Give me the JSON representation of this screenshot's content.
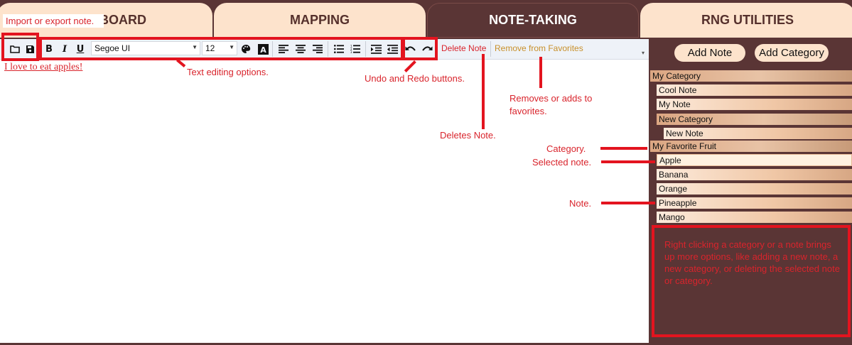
{
  "tabs": [
    {
      "label": "DASHBOARD",
      "active": false
    },
    {
      "label": "MAPPING",
      "active": false
    },
    {
      "label": "NOTE-TAKING",
      "active": true
    },
    {
      "label": "RNG UTILITIES",
      "active": false
    }
  ],
  "toolbar": {
    "open_icon": "folder-open-icon",
    "save_icon": "save-icon",
    "bold": "B",
    "italic": "I",
    "underline": "U",
    "font_family": "Segoe UI",
    "font_size": "12",
    "delete_note": "Delete Note",
    "remove_favorites": "Remove from Favorites"
  },
  "editor": {
    "body_text": "I love to eat apples!"
  },
  "sidebar": {
    "add_note": "Add Note",
    "add_category": "Add Category",
    "tree": [
      {
        "label": "My Category",
        "kind": "category"
      },
      {
        "label": "Cool Note",
        "kind": "note"
      },
      {
        "label": "My Note",
        "kind": "note"
      },
      {
        "label": "New Category",
        "kind": "category"
      },
      {
        "label": "New Note",
        "kind": "note"
      },
      {
        "label": "My Favorite Fruit",
        "kind": "category"
      },
      {
        "label": "Apple",
        "kind": "note",
        "selected": true
      },
      {
        "label": "Banana",
        "kind": "note"
      },
      {
        "label": "Orange",
        "kind": "note"
      },
      {
        "label": "Pineapple",
        "kind": "note"
      },
      {
        "label": "Mango",
        "kind": "note"
      }
    ]
  },
  "annotations": {
    "import_export": "Import or export note.",
    "text_editing": "Text editing options.",
    "undo_redo": "Undo and Redo buttons.",
    "favorites_line1": "Removes or adds to",
    "favorites_line2": "favorites.",
    "deletes_note": "Deletes Note.",
    "category": "Category.",
    "selected_note": "Selected note.",
    "note": "Note.",
    "right_click": "Right clicking a category or a note brings up more options, like adding a new note, a new category, or deleting the selected note or category."
  },
  "colors": {
    "background": "#5a3535",
    "tab_light": "#fde3cc",
    "annotation_red": "#e3141f",
    "favorites_link": "#c8902a"
  }
}
